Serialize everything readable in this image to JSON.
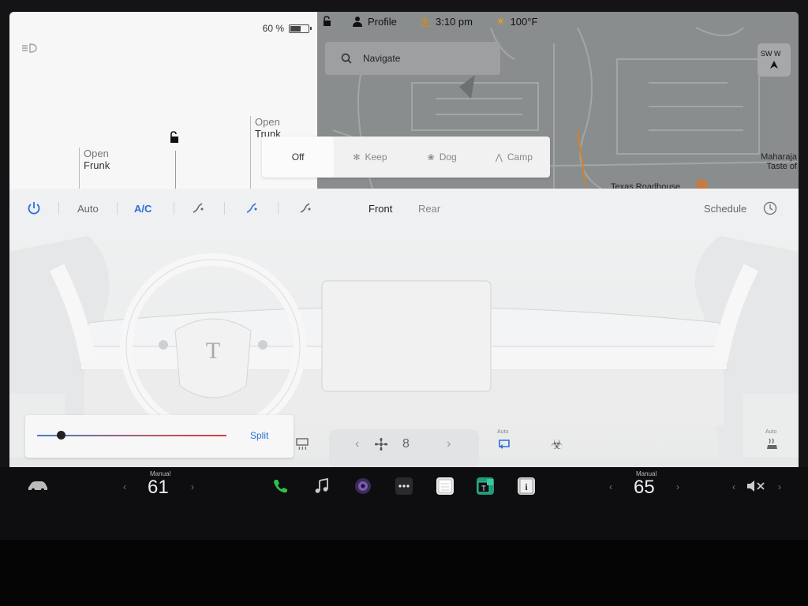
{
  "status": {
    "battery": "60 %",
    "battery_level": 0.6,
    "profile": "Profile",
    "time": "3:10 pm",
    "temperature": "100°F"
  },
  "car": {
    "frunk_action": "Open",
    "frunk_label": "Frunk",
    "trunk_action": "Open",
    "trunk_label": "Trunk"
  },
  "map": {
    "search_placeholder": "Navigate",
    "compass": "SW W",
    "poi_1_line1": "Maharaja",
    "poi_1_line2": "Taste of",
    "poi_2": "Texas Roadhouse"
  },
  "modes": [
    {
      "label": "Off"
    },
    {
      "label": "Keep"
    },
    {
      "label": "Dog"
    },
    {
      "label": "Camp"
    }
  ],
  "climate": {
    "auto": "Auto",
    "ac": "A/C",
    "front": "Front",
    "rear": "Rear",
    "schedule": "Schedule",
    "split": "Split",
    "fan_speed": "8",
    "recirc_label": "Auto",
    "seat_label": "Auto"
  },
  "taskbar": {
    "driver_mode": "Manual",
    "driver_temp": "61",
    "passenger_mode": "Manual",
    "passenger_temp": "65"
  },
  "colors": {
    "accent": "#2a6fd6",
    "phone": "#2fbf4a"
  }
}
